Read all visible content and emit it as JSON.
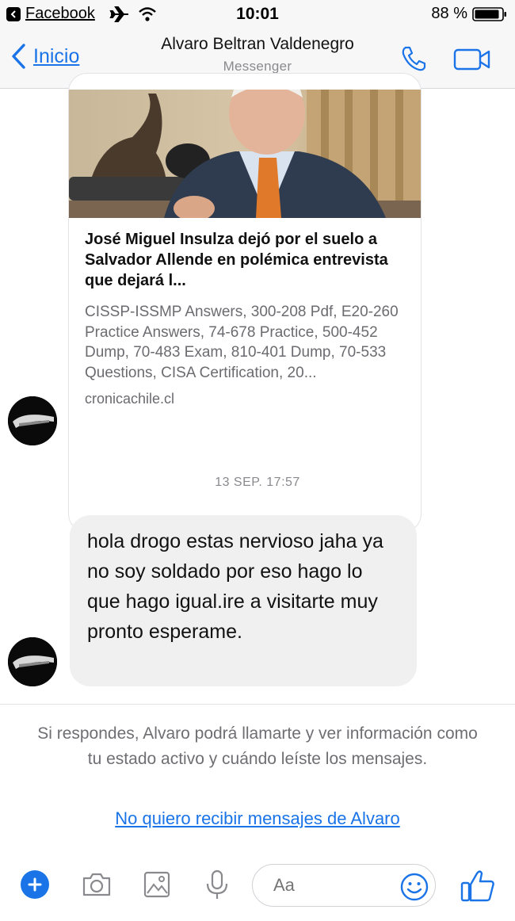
{
  "status_bar": {
    "back_app": "Facebook",
    "time": "10:01",
    "battery": "88 %"
  },
  "nav": {
    "back_label": "Inicio",
    "title": "Alvaro Beltran Valdenegro",
    "subtitle": "Messenger"
  },
  "link_card": {
    "title": "José Miguel Insulza dejó por el suelo a Salvador Allende en polémica entrevista que dejará l...",
    "description": "CISSP-ISSMP Answers, 300-208 Pdf, E20-260 Practice Answers, 74-678 Practice, 500-452 Dump,   70-483 Exam,   810-401 Dump,   70-533 Questions,   CISA Certification,   20...",
    "domain": "cronicachile.cl"
  },
  "timestamp": "13 SEP. 17:57",
  "message": {
    "text": "hola drogo estas nervioso jaha ya no soy soldado por eso hago lo que hago igual.ire a visitarte muy pronto esperame."
  },
  "notice": {
    "text": "Si respondes, Alvaro podrá llamarte y ver información como tu estado activo y cuándo leíste los mensajes.",
    "link": "No quiero recibir mensajes de Alvaro"
  },
  "composer": {
    "placeholder": "Aa"
  },
  "colors": {
    "accent": "#1a74e8",
    "bubble": "#f1f0f0",
    "muted_text": "#6e6e73"
  },
  "icons": [
    "back-app-icon",
    "airplane-icon",
    "wifi-icon",
    "battery-icon",
    "back-chevron-icon",
    "phone-icon",
    "video-icon",
    "plus-icon",
    "camera-icon",
    "photo-icon",
    "microphone-icon",
    "emoji-icon",
    "thumbs-up-icon"
  ]
}
